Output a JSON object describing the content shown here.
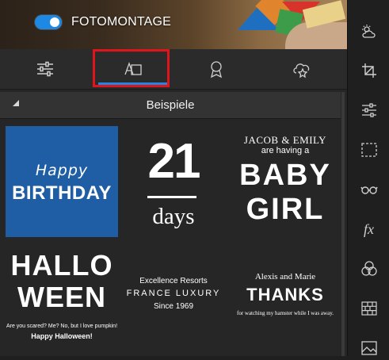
{
  "header": {
    "toggle_label": "FOTOMONTAGE",
    "toggle_on": true
  },
  "tabs": [
    {
      "name": "adjust",
      "icon": "sliders-icon"
    },
    {
      "name": "text",
      "icon": "text-frame-icon",
      "selected": true
    },
    {
      "name": "badge",
      "icon": "award-ribbon-icon"
    },
    {
      "name": "stickers",
      "icon": "cloud-star-icon"
    }
  ],
  "section": {
    "title": "Beispiele"
  },
  "templates": {
    "birthday": {
      "line1": "Happy",
      "line2": "BIRTHDAY",
      "background": "#1f5ea5"
    },
    "days": {
      "number": "21",
      "word": "days"
    },
    "baby": {
      "names": "JACOB & EMILY",
      "having": "are having a",
      "line1": "BABY",
      "line2": "GIRL"
    },
    "halloween": {
      "line1": "HALLO",
      "line2": "WEEN",
      "small1": "Are you scared? Me? No, but I love pumpkin!",
      "small2": "Happy Halloween!"
    },
    "france": {
      "line1": "Excellence Resorts",
      "line2": "FRANCE LUXURY",
      "line3": "Since 1969"
    },
    "thanks": {
      "names": "Alexis and Marie",
      "title": "THANKS",
      "note": "for watching my hamster while I was away."
    }
  },
  "rail_icons": [
    "weather-cloud-icon",
    "crop-icon",
    "adjust-sliders-icon",
    "selection-icon",
    "glasses-icon",
    "fx-icon",
    "color-circles-icon",
    "brick-texture-icon",
    "image-icon"
  ],
  "rail": {
    "fx_label": "fx"
  },
  "colors": {
    "accent": "#1e88e5",
    "highlight": "#e0141b"
  }
}
